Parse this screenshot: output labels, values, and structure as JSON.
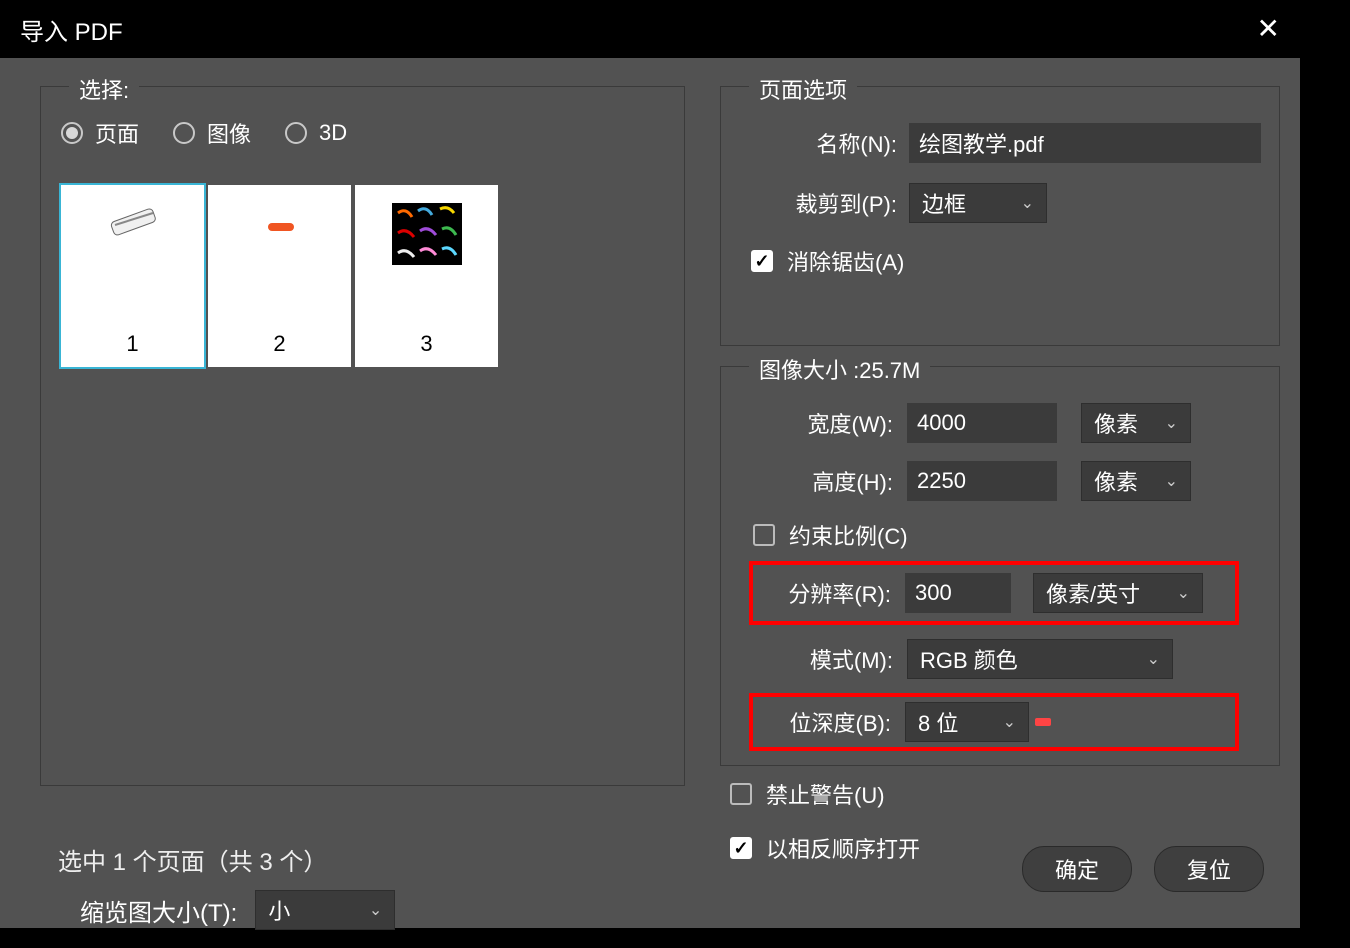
{
  "title": "导入 PDF",
  "select": {
    "legend": "选择:",
    "radios": {
      "pages": "页面",
      "images": "图像",
      "threeD": "3D"
    },
    "thumbs": [
      "1",
      "2",
      "3"
    ]
  },
  "status": "选中 1 个页面（共 3 个）",
  "thumbSize": {
    "label": "缩览图大小(T):",
    "value": "小"
  },
  "pageOptions": {
    "legend": "页面选项",
    "nameLabel": "名称(N):",
    "nameValue": "绘图教学.pdf",
    "cropLabel": "裁剪到(P):",
    "cropValue": "边框",
    "antiAlias": "消除锯齿(A)"
  },
  "imageSize": {
    "legend": "图像大小 :25.7M",
    "widthLabel": "宽度(W):",
    "widthValue": "4000",
    "widthUnit": "像素",
    "heightLabel": "高度(H):",
    "heightValue": "2250",
    "heightUnit": "像素",
    "constrain": "约束比例(C)",
    "resLabel": "分辨率(R):",
    "resValue": "300",
    "resUnit": "像素/英寸",
    "modeLabel": "模式(M):",
    "modeValue": "RGB 颜色",
    "bitLabel": "位深度(B):",
    "bitValue": "8 位"
  },
  "suppress": "禁止警告(U)",
  "reverse": "以相反顺序打开",
  "ok": "确定",
  "reset": "复位"
}
